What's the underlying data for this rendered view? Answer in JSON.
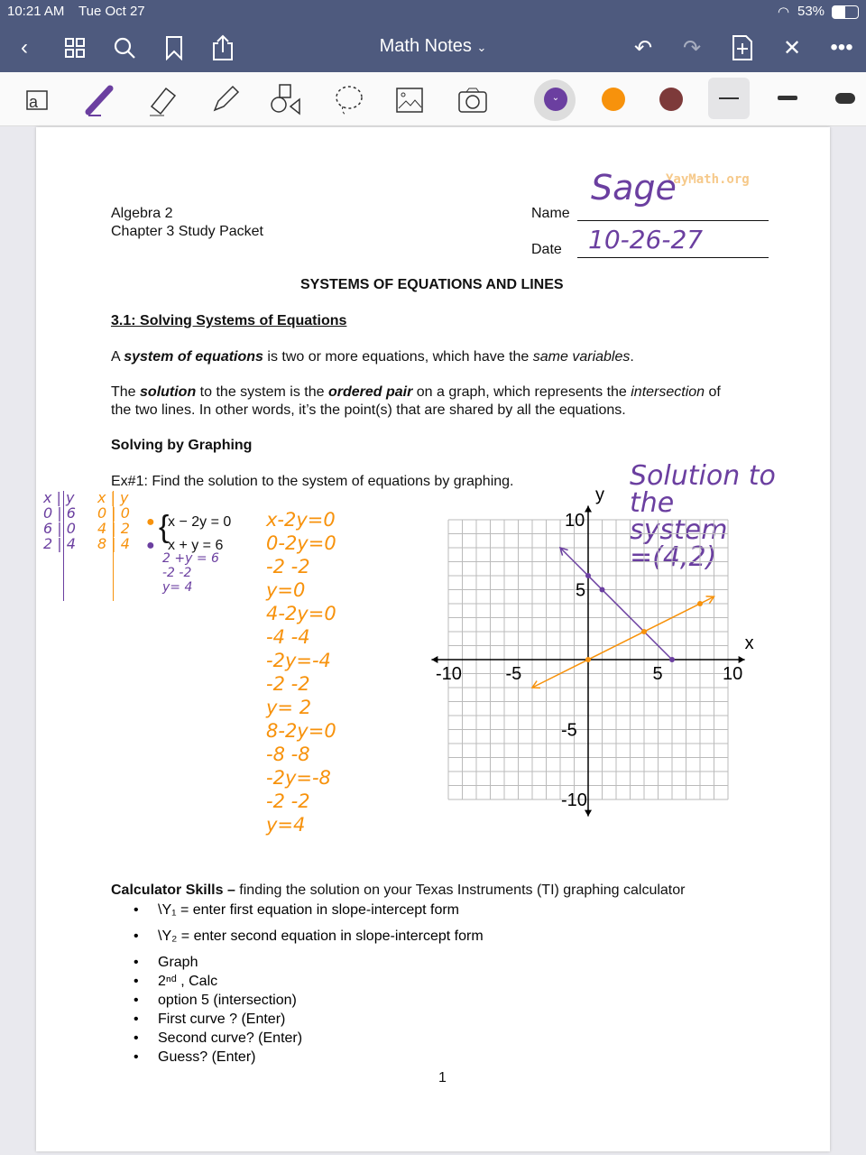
{
  "status": {
    "time": "10:21 AM",
    "date": "Tue Oct 27",
    "battery": "53%"
  },
  "app": {
    "title": "Math Notes",
    "title_caret": "⌄"
  },
  "icons": {
    "back": "chevron-left-icon",
    "grid": "grid-icon",
    "search": "search-icon",
    "bookmark": "bookmark-icon",
    "share": "share-icon",
    "undo": "undo-icon",
    "redo": "redo-icon",
    "add_page": "add-page-icon",
    "close_tools": "close-icon",
    "more": "more-icon"
  },
  "tools": [
    "text-tool",
    "pen-tool",
    "eraser-tool",
    "highlighter-tool",
    "shapes-tool",
    "lasso-tool",
    "image-tool",
    "camera-tool"
  ],
  "colors": {
    "purple": "#6b3fa0",
    "orange": "#f7920c",
    "maroon": "#7d3a3a",
    "topbar": "#4e5a7e"
  },
  "doc": {
    "course": "Algebra 2",
    "packet": "Chapter 3 Study Packet",
    "name_label": "Name",
    "date_label": "Date",
    "watermark": "YayMath.org",
    "heading": "SYSTEMS OF EQUATIONS AND LINES",
    "section": "3.1: Solving Systems of Equations",
    "p1a": "A ",
    "p1b": "system of equations",
    "p1c": " is two or more equations, which have the ",
    "p1d": "same variables",
    ".": ".",
    "p2a": "The ",
    "p2b": "solution",
    "p2c": " to the system is the ",
    "p2d": "ordered pair",
    "p2e": " on a graph, which represents the ",
    "p2f": "intersection",
    "p2g": " of",
    "p2h": "the two lines. In other words, it’s the point(s) that are shared by all the equations.",
    "sub": "Solving by Graphing",
    "ex": "Ex#1: Find the solution to the system of equations by graphing.",
    "eq1": "x − 2y = 0",
    "eq2": "x + y = 6",
    "calc_title": "Calculator Skills –",
    "calc_rest": " finding the solution on your Texas Instruments (TI) graphing calculator",
    "bullets": [
      "\\Y₁ =   enter first equation in slope-intercept form",
      "\\Y₂ =   enter second equation in slope-intercept form",
      "Graph",
      "2ⁿᵈ , Calc",
      "option 5 (intersection)",
      "First curve ?  (Enter)",
      "Second curve?  (Enter)",
      "Guess?  (Enter)"
    ],
    "page_number": "1"
  },
  "handwriting": {
    "name": "Sage",
    "date": "10-26-27",
    "solution": [
      "Solution to",
      "the",
      "system",
      "=(4,2)"
    ],
    "purple_table": {
      "header": "x | y",
      "rows": [
        "0 | 6",
        "6 | 0",
        "2 | 4"
      ]
    },
    "orange_table": {
      "header": "x | y",
      "rows": [
        "0 | 0",
        "4 | 2",
        "8 | 4"
      ]
    },
    "purple_work": [
      "2 +y = 6",
      "-2      -2",
      "y= 4"
    ],
    "orange_work": [
      "x-2y=0",
      "0-2y=0",
      "-2      -2",
      "y=0",
      "4-2y=0",
      "-4      -4",
      "-2y=-4",
      "-2     -2",
      "y= 2",
      "8-2y=0",
      "-8       -8",
      "-2y=-8",
      "-2    -2",
      "y=4"
    ]
  },
  "chart_data": {
    "type": "line",
    "xlabel": "x",
    "ylabel": "y",
    "xlim": [
      -10,
      10
    ],
    "ylim": [
      -10,
      10
    ],
    "grid": true,
    "x_ticks": [
      "-10",
      "-5",
      "5",
      "10"
    ],
    "y_ticks": [
      "10",
      "5",
      "-5",
      "-10"
    ],
    "series": [
      {
        "color": "#6b3fa0",
        "equation": "x + y = 6",
        "line": [
          [
            -2,
            8
          ],
          [
            6,
            0
          ]
        ],
        "points": [
          [
            0,
            6
          ],
          [
            1,
            5
          ],
          [
            6,
            0
          ]
        ]
      },
      {
        "color": "#f7920c",
        "equation": "x - 2y = 0",
        "line": [
          [
            -4,
            -2
          ],
          [
            9,
            4.5
          ]
        ],
        "points": [
          [
            0,
            0
          ],
          [
            4,
            2
          ],
          [
            8,
            4
          ]
        ]
      }
    ]
  }
}
